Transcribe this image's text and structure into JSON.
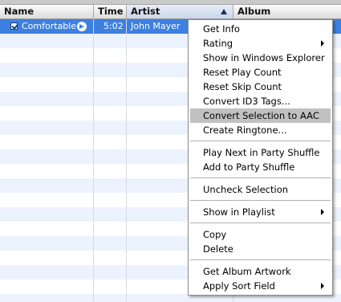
{
  "columns": {
    "name": "Name",
    "time": "Time",
    "artist": "Artist",
    "album": "Album"
  },
  "track": {
    "checked": true,
    "name": "Comfortable",
    "time": "5:02",
    "artist": "John Mayer"
  },
  "menu": {
    "get_info": "Get Info",
    "rating": "Rating",
    "show_in_explorer": "Show in Windows Explorer",
    "reset_play_count": "Reset Play Count",
    "reset_skip_count": "Reset Skip Count",
    "convert_id3": "Convert ID3 Tags...",
    "convert_aac": "Convert Selection to AAC",
    "create_ringtone": "Create Ringtone...",
    "play_next_party": "Play Next in Party Shuffle",
    "add_party": "Add to Party Shuffle",
    "uncheck_selection": "Uncheck Selection",
    "show_in_playlist": "Show in Playlist",
    "copy": "Copy",
    "delete": "Delete",
    "get_album_artwork": "Get Album Artwork",
    "apply_sort_field": "Apply Sort Field"
  },
  "colors": {
    "selection": "#3d80df",
    "alternate_row": "#edf3fe",
    "menu_highlight": "#c1c1c1"
  },
  "icons": [
    "checkbox-icon",
    "go-arrow-icon",
    "sort-ascending-icon",
    "submenu-arrow-icon"
  ]
}
